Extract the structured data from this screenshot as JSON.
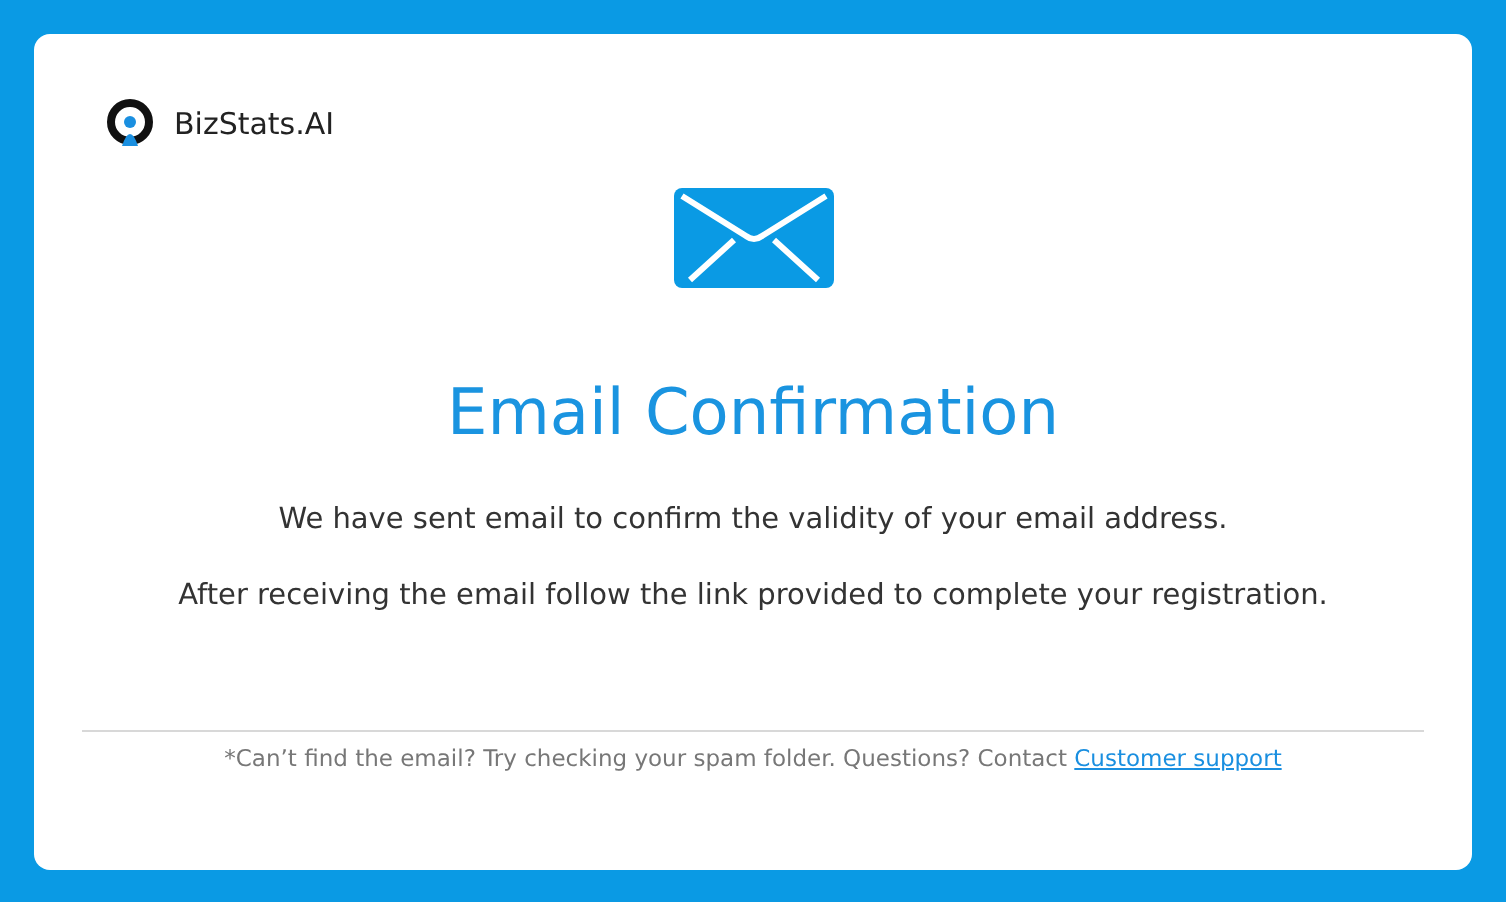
{
  "brand": {
    "name": "BizStats.AI"
  },
  "title": "Email Confirmation",
  "paragraphs": [
    "We have sent email to confirm the validity of your email address.",
    "After receiving the email follow the link provided to complete your registration."
  ],
  "footer": {
    "text": "*Can’t find the email? Try checking your spam folder. Questions? Contact",
    "link": "Customer support"
  }
}
